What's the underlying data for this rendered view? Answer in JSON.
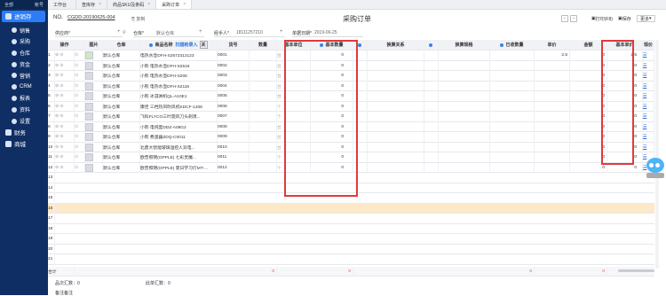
{
  "sidebar": {
    "brand": "全部",
    "brand2": "帐号",
    "module": "进销存",
    "items": [
      {
        "label": "销售",
        "icon": "cart-icon"
      },
      {
        "label": "采购",
        "icon": "truck-icon"
      },
      {
        "label": "仓库",
        "icon": "warehouse-icon"
      },
      {
        "label": "资金",
        "icon": "money-icon"
      },
      {
        "label": "营销",
        "icon": "megaphone-icon"
      },
      {
        "label": "CRM",
        "icon": "users-icon"
      },
      {
        "label": "报表",
        "icon": "chart-icon"
      },
      {
        "label": "资料",
        "icon": "folder-icon"
      },
      {
        "label": "设置",
        "icon": "gear-icon"
      }
    ],
    "sections": [
      {
        "label": "财务"
      },
      {
        "label": "商城"
      }
    ]
  },
  "tabs": [
    {
      "label": "工作台",
      "close": ""
    },
    {
      "label": "查库存",
      "close": "×"
    },
    {
      "label": "商品SKU及条码",
      "close": "×"
    },
    {
      "label": "采购订单",
      "close": "×"
    }
  ],
  "toolbar": {
    "no_label": "NO.",
    "no_value": "CGDD-20190625-004",
    "copy": "复制",
    "title": "采购订单",
    "print": "打印(F8)",
    "save": "保存",
    "more": "更多"
  },
  "form": {
    "supplier_label": "供应商*",
    "warehouse_label": "仓库*",
    "warehouse_value": "默认仓库",
    "handler_label": "经手人*",
    "handler_value": "18111257210",
    "date_label": "单据日期*",
    "date_value": "2019-06-25"
  },
  "columns": [
    "",
    "操作",
    "",
    "图片",
    "仓库",
    "商品名称",
    "货号",
    "数量",
    "基本单位",
    "基本数量",
    "",
    "换算关系",
    "",
    "换算规格",
    "已收数量",
    "单价",
    "金额",
    "基本单价",
    "现价"
  ],
  "columns_extra": {
    "name_sub": "扫描枪录入",
    "name_btn": "关"
  },
  "rows": [
    {
      "no": "1",
      "wh": "默认仓库",
      "name": "电热水壶DFH-S2672312123",
      "code": "0001",
      "unit": "台",
      "qty": "0",
      "price": "2.5",
      "amount": "0",
      "base": "2.5",
      "has_img": true
    },
    {
      "no": "2",
      "wh": "默认仓库",
      "name": "小熊 电热水壶DFH-S2516",
      "code": "0002",
      "unit": "台",
      "qty": "0",
      "price": "",
      "amount": "0",
      "base": "0",
      "has_img": false
    },
    {
      "no": "3",
      "wh": "默认仓库",
      "name": "小熊 电热水壶DFH-S205",
      "code": "0003",
      "unit": "台",
      "qty": "0",
      "price": "",
      "amount": "0",
      "base": "0",
      "has_img": false
    },
    {
      "no": "4",
      "wh": "默认仓库",
      "name": "小熊 电热水壶DFH-S2116",
      "code": "0004",
      "unit": "台",
      "qty": "0",
      "price": "",
      "amount": "0",
      "base": "0",
      "has_img": false
    },
    {
      "no": "5",
      "wh": "默认仓库",
      "name": "小熊 冰淇淋机QL-A10E1",
      "code": "0005",
      "unit": "台",
      "qty": "0",
      "price": "",
      "amount": "0",
      "base": "0",
      "has_img": false
    },
    {
      "no": "6",
      "wh": "默认仓库",
      "name": "康佳 三档热风吹风机KDCF-1208",
      "code": "0006",
      "unit": "个",
      "qty": "0",
      "price": "",
      "amount": "0",
      "base": "0",
      "has_img": false
    },
    {
      "no": "7",
      "wh": "默认仓库",
      "name": "飞科FLYCO三叶旋风刀头剃须...",
      "code": "0007",
      "unit": "个",
      "qty": "0",
      "price": "",
      "amount": "0",
      "base": "0",
      "has_img": false
    },
    {
      "no": "8",
      "wh": "默认仓库",
      "name": "小熊 电炖盅DDZ-A08G2",
      "code": "0008",
      "unit": "台",
      "qty": "0",
      "price": "",
      "amount": "0",
      "base": "0",
      "has_img": false
    },
    {
      "no": "9",
      "wh": "默认仓库",
      "name": "小熊 煮蛋器ZDQ-C0011",
      "code": "0009",
      "unit": "台",
      "qty": "0",
      "price": "",
      "amount": "0",
      "base": "0",
      "has_img": false
    },
    {
      "no": "10",
      "wh": "默认仓库",
      "name": "北鼎大智能玻璃温控人双电...",
      "code": "0010",
      "unit": "台",
      "qty": "0",
      "price": "",
      "amount": "0",
      "base": "0",
      "has_img": false
    },
    {
      "no": "11",
      "wh": "默认仓库",
      "name": "欧普照明(OPPLE) 七彩灵魔...",
      "code": "0011",
      "unit": "个",
      "qty": "0",
      "price": "",
      "amount": "0",
      "base": "0",
      "has_img": false
    },
    {
      "no": "12",
      "wh": "默认仓库",
      "name": "欧普照明(OPPLE) 夏日学习灯MT-...",
      "code": "0012",
      "unit": "个",
      "qty": "0",
      "price": "",
      "amount": "0",
      "base": "0",
      "has_img": false
    }
  ],
  "empty_rows": [
    "13",
    "14",
    "15",
    "16",
    "17",
    "18",
    "19",
    "20",
    "21"
  ],
  "total": {
    "label": "合计",
    "qty": "0",
    "base": "0",
    "recv": "0",
    "amount": "0",
    "baseprice": "0"
  },
  "bottom": {
    "items_label": "品次汇数：0",
    "actual_label": "此单汇数：0",
    "remark_label": "备注备注"
  }
}
